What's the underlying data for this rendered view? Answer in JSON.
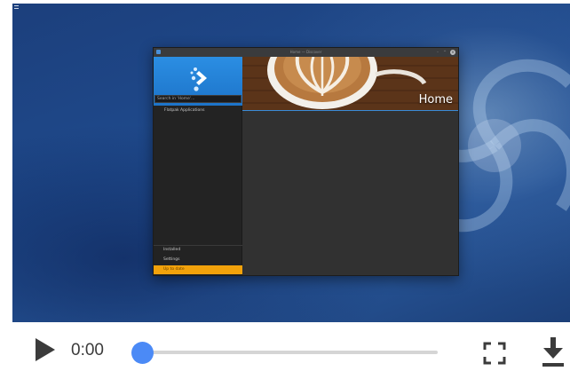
{
  "app_window": {
    "title": "Home — Discover",
    "minimize_glyph": "–",
    "maximize_glyph": "^",
    "close_glyph": "×",
    "search_placeholder": "Search in 'Home'...",
    "nav": {
      "top_items": [
        {
          "label": "Flatpak Applications"
        }
      ],
      "bottom_items": [
        {
          "label": "Installed"
        },
        {
          "label": "Settings"
        },
        {
          "label": "Up to date"
        }
      ]
    },
    "banner": {
      "title": "Home"
    }
  },
  "player": {
    "current_time": "0:00",
    "progress": 0,
    "icons": {
      "play": "play-icon",
      "fullscreen": "fullscreen-icon",
      "download": "download-icon"
    }
  },
  "colors": {
    "accent": "#4b8af6",
    "discover_blue": "#2b8ee3",
    "update_orange": "#f2a20b"
  }
}
